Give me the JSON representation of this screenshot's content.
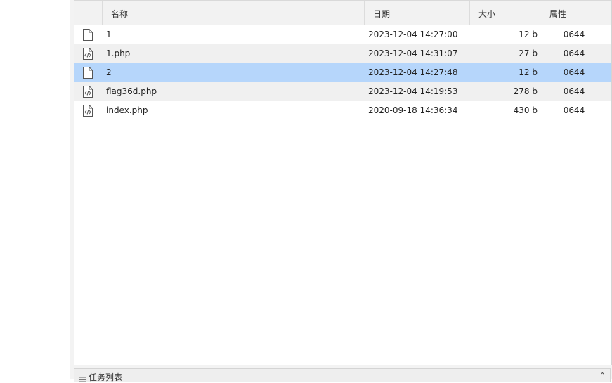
{
  "columns": {
    "name": "名称",
    "date": "日期",
    "size": "大小",
    "attr": "属性"
  },
  "files": [
    {
      "name": "1",
      "date": "2023-12-04 14:27:00",
      "size": "12 b",
      "attr": "0644",
      "icon": "file-icon",
      "selected": false
    },
    {
      "name": "1.php",
      "date": "2023-12-04 14:31:07",
      "size": "27 b",
      "attr": "0644",
      "icon": "code-file-icon",
      "selected": false
    },
    {
      "name": "2",
      "date": "2023-12-04 14:27:48",
      "size": "12 b",
      "attr": "0644",
      "icon": "file-icon",
      "selected": true
    },
    {
      "name": "flag36d.php",
      "date": "2023-12-04 14:19:53",
      "size": "278 b",
      "attr": "0644",
      "icon": "code-file-icon",
      "selected": false
    },
    {
      "name": "index.php",
      "date": "2020-09-18 14:36:34",
      "size": "430 b",
      "attr": "0644",
      "icon": "code-file-icon",
      "selected": false
    }
  ],
  "task_panel": {
    "label": "任务列表",
    "icon": "list-icon",
    "collapse_icon": "chevron-up-icon"
  },
  "colors": {
    "selected_row": "#b6d6fb",
    "alt_row": "#f0f0f0",
    "header_bg": "#f2f2f2"
  }
}
